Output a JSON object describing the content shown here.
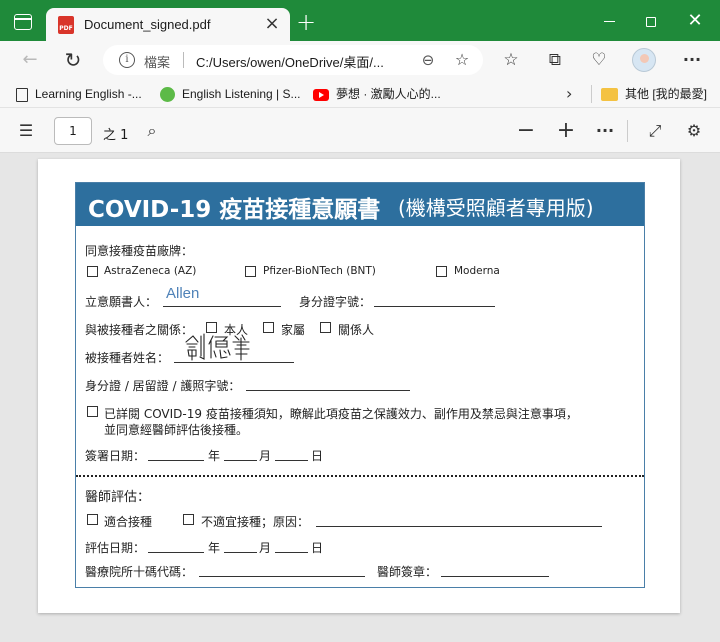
{
  "browser": {
    "tab_title": "Document_signed.pdf",
    "pdf_badge": "PDF",
    "address": {
      "info_label": "檔案",
      "url": "C:/Users/owen/OneDrive/桌面/..."
    },
    "bookmarks": [
      {
        "label": "Learning English -..."
      },
      {
        "label": "English Listening | S..."
      },
      {
        "label": "夢想 · 激勵人心的..."
      },
      {
        "label": "其他 [我的最愛]"
      }
    ]
  },
  "pdf_toolbar": {
    "page_number": "1",
    "page_total": "之 1"
  },
  "form": {
    "title": "COVID-19 疫苗接種意願書",
    "title_sub": "(機構受照顧者專用版)",
    "brand_label": "同意接種疫苗廠牌：",
    "brands": [
      "AstraZeneca (AZ)",
      "Pfizer-BioNTech (BNT)",
      "Moderna"
    ],
    "signer_label": "立意願書人：",
    "signer_value": "Allen",
    "id_label": "身分證字號：",
    "relation_label": "與被接種者之關係：",
    "relations": [
      "本人",
      "家屬",
      "關係人"
    ],
    "recipient_label": "被接種者姓名：",
    "recipient_doc_label": "身分證 / 居留證 / 護照字號：",
    "consent_line1": "已詳閱 COVID-19 疫苗接種須知，瞭解此項疫苗之保護效力、副作用及禁忌與注意事項，",
    "consent_line2": "並同意經醫師評估後接種。",
    "date_label": "簽署日期：",
    "year": "年",
    "month": "月",
    "day": "日",
    "doctor_section": "醫師評估：",
    "suitable": "適合接種",
    "not_suitable": "不適宜接種；原因：",
    "eval_date_label": "評估日期：",
    "hospital_code_label": "醫療院所十碼代碼：",
    "doctor_stamp_label": "醫師簽章："
  }
}
